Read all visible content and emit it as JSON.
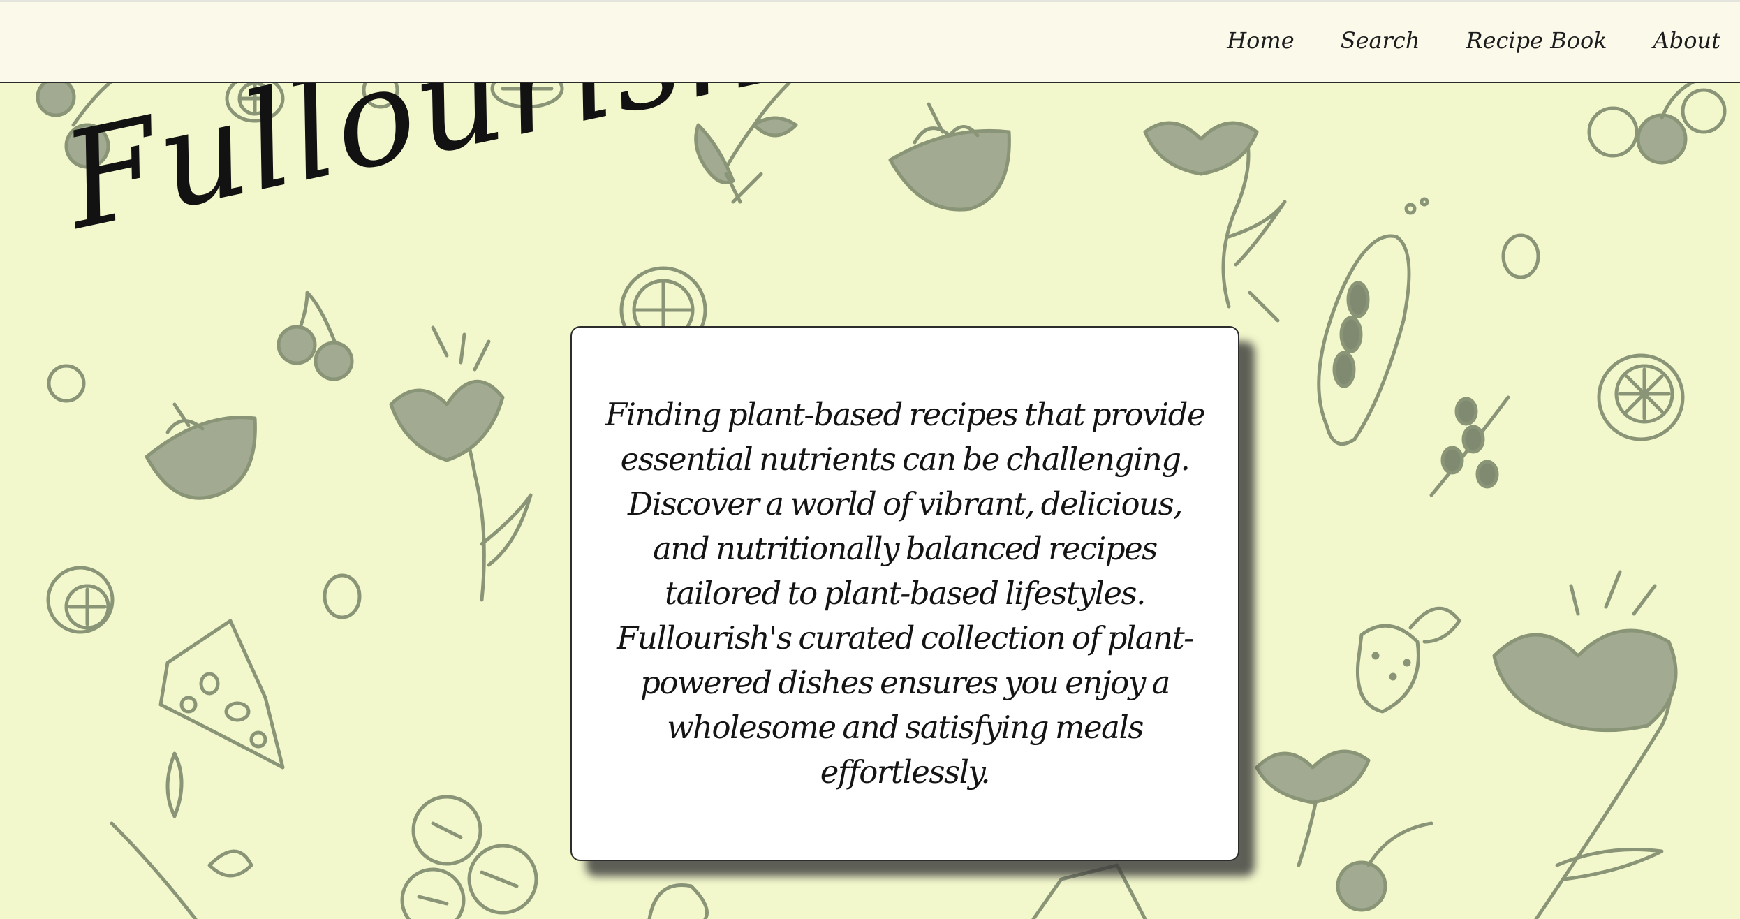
{
  "nav": {
    "home_label": "Home",
    "search_label": "Search",
    "recipe_book_label": "Recipe Book",
    "about_label": "About"
  },
  "brand": {
    "logo_text": "Fullourish"
  },
  "hero": {
    "description": "Finding plant-based recipes that provide essential nutrients can be challenging. Discover a world of vibrant, delicious, and nutritionally balanced recipes tailored to plant-based lifestyles. Fullourish's curated collection of plant-powered dishes ensures you enjoy a wholesome and satisfying meals effortlessly."
  },
  "colors": {
    "page_background": "#f3f8cc",
    "topbar_background": "#faf9ea",
    "illustration": "#8a9578",
    "card_background": "#ffffff",
    "text": "#141414"
  },
  "icons": [
    "cherry-icon",
    "lily-flower-icon",
    "noodle-bowl-icon",
    "lemon-slice-icon",
    "baguette-icon",
    "olive-branch-icon",
    "cheese-wedge-icon",
    "tomato-icon",
    "strawberry-icon",
    "pea-icon",
    "leaf-sprig-icon"
  ]
}
